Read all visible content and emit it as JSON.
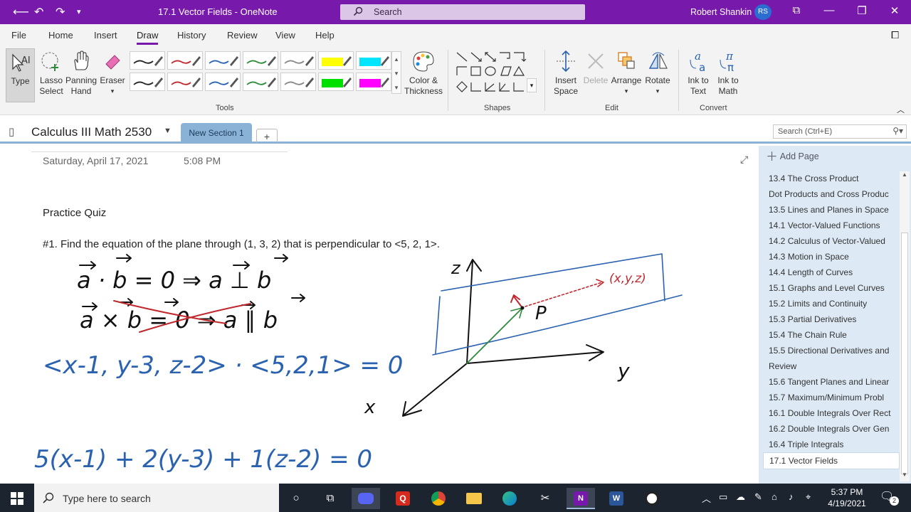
{
  "titlebar": {
    "doc_title": "17.1 Vector Fields - OneNote",
    "search_placeholder": "Search",
    "user_name": "Robert Shankin",
    "user_initials": "RS"
  },
  "menu": {
    "tabs": [
      "File",
      "Home",
      "Insert",
      "Draw",
      "History",
      "Review",
      "View",
      "Help"
    ],
    "active": "Draw"
  },
  "ribbon": {
    "type_label": "Type",
    "lasso_label": "Lasso Select",
    "lasso_line1": "Lasso",
    "lasso_line2": "Select",
    "panning_line1": "Panning",
    "panning_line2": "Hand",
    "eraser_label": "Eraser",
    "color_line1": "Color &",
    "color_line2": "Thickness",
    "tools_group": "Tools",
    "shapes_group": "Shapes",
    "insert_space_line1": "Insert",
    "insert_space_line2": "Space",
    "delete_label": "Delete",
    "arrange_label": "Arrange",
    "rotate_label": "Rotate",
    "edit_group": "Edit",
    "ink_text_line1": "Ink to",
    "ink_text_line2": "Text",
    "ink_math_line1": "Ink to",
    "ink_math_line2": "Math",
    "convert_group": "Convert",
    "pens_row1": [
      "#222222",
      "#c0282d",
      "#2a62b0",
      "#2e8b3a",
      "#888888",
      "#ffff00",
      "#00e5ff"
    ],
    "pens_row2": [
      "#222222",
      "#c0282d",
      "#2a62b0",
      "#2e8b3a",
      "#888888",
      "#00e000",
      "#ff00ff"
    ]
  },
  "notebook": {
    "name": "Calculus III Math 2530",
    "section": "New Section 1",
    "add_section": "+",
    "page_search_placeholder": "Search (Ctrl+E)"
  },
  "page": {
    "date": "Saturday, April 17, 2021",
    "time": "5:08 PM",
    "heading": "Practice Quiz",
    "question": "#1. Find the equation of the plane through (1, 3, 2) that is perpendicular to  <5, 2, 1>."
  },
  "pages_panel": {
    "add_page": "Add Page",
    "items": [
      "13.4 The Cross Product",
      "Dot Products and Cross Produc",
      "13.5 Lines and Planes in Space",
      "14.1 Vector-Valued Functions",
      "14.2 Calculus of Vector-Valued",
      "14.3 Motion in Space",
      "14.4 Length of Curves",
      "15.1 Graphs and Level Curves",
      "15.2 Limits and Continuity",
      "15.3 Partial Derivatives",
      "15.4 The Chain Rule",
      "15.5 Directional Derivatives and",
      "Review",
      "15.6 Tangent Planes and Linear",
      "15.7 Maximum/Minimum Probl",
      "16.1 Double Integrals Over Rect",
      "16.2 Double Integrals Over Gen",
      "16.4 Triple Integrals",
      "17.1 Vector Fields"
    ],
    "active_item": "17.1 Vector Fields"
  },
  "taskbar": {
    "search_placeholder": "Type here to search",
    "time": "5:37 PM",
    "date": "4/19/2021",
    "notification_count": "2"
  },
  "handwriting": {
    "line1": "a · b = 0 ⇒ a ⊥ b",
    "line2": "a × b = 0 ⇒ a ∥ b",
    "line3": "<x-1, y-3, z-2> · <5,2,1> = 0",
    "line4": "5(x-1) + 2(y-3) + 1(z-2) = 0",
    "axis_z": "z",
    "axis_y": "y",
    "axis_x": "x",
    "point_label": "P",
    "point_xyz": "(x,y,z)"
  },
  "colors": {
    "accent": "#7719aa",
    "section_tab": "#8ab2d6",
    "pages_bg": "#dde9f5",
    "ink_black": "#111111",
    "ink_red": "#c0282d",
    "ink_blue": "#2a62b0",
    "ink_green": "#2e8b3a"
  }
}
